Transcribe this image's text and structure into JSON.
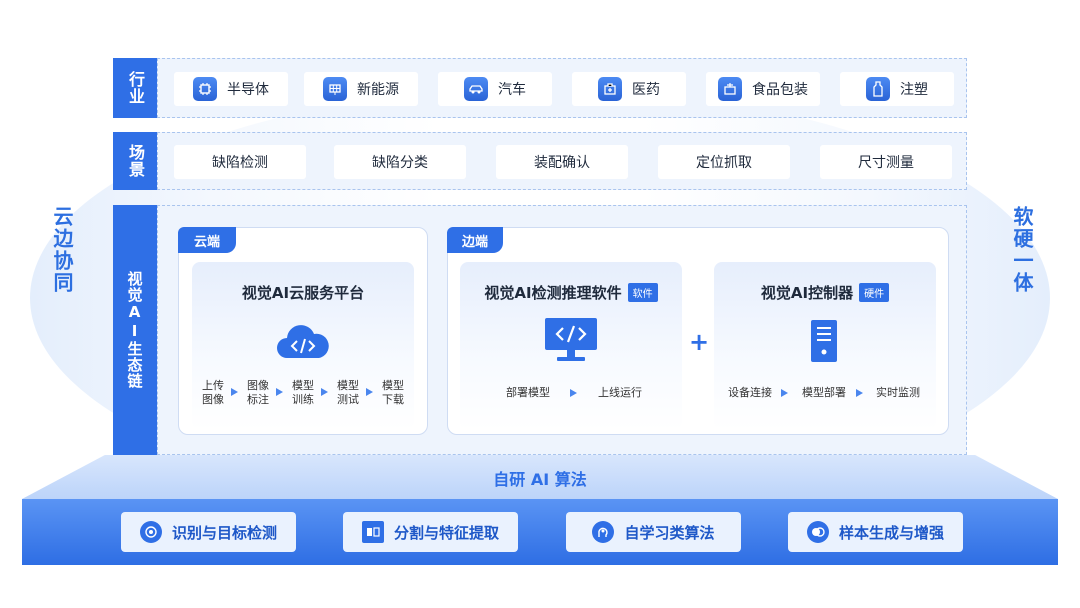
{
  "side": {
    "left": "云边协同",
    "right": "软硬一体"
  },
  "industry": {
    "tag": "行业",
    "items": [
      {
        "label": "半导体",
        "icon": "chip-icon"
      },
      {
        "label": "新能源",
        "icon": "solar-panel-icon"
      },
      {
        "label": "汽车",
        "icon": "car-icon"
      },
      {
        "label": "医药",
        "icon": "medical-kit-icon"
      },
      {
        "label": "食品包装",
        "icon": "food-package-icon"
      },
      {
        "label": "注塑",
        "icon": "bottle-icon"
      }
    ]
  },
  "scene": {
    "tag": "场景",
    "items": [
      "缺陷检测",
      "缺陷分类",
      "装配确认",
      "定位抓取",
      "尺寸测量"
    ]
  },
  "eco": {
    "tag": "视觉AI生态链",
    "cloud": {
      "tab": "云端",
      "title": "视觉AI云服务平台",
      "steps": [
        {
          "l1": "上传",
          "l2": "图像"
        },
        {
          "l1": "图像",
          "l2": "标注"
        },
        {
          "l1": "模型",
          "l2": "训练"
        },
        {
          "l1": "模型",
          "l2": "测试"
        },
        {
          "l1": "模型",
          "l2": "下载"
        }
      ]
    },
    "edge": {
      "tab": "边端",
      "software": {
        "title": "视觉AI检测推理软件",
        "badge": "软件",
        "steps": [
          "部署模型",
          "上线运行"
        ]
      },
      "plus": "+",
      "hardware": {
        "title": "视觉AI控制器",
        "badge": "硬件",
        "steps": [
          "设备连接",
          "模型部署",
          "实时监测"
        ]
      }
    }
  },
  "algo": {
    "title": "自研 AI 算法",
    "items": [
      {
        "label": "识别与目标检测",
        "icon": "target-icon"
      },
      {
        "label": "分割与特征提取",
        "icon": "segment-icon"
      },
      {
        "label": "自学习类算法",
        "icon": "brain-head-icon"
      },
      {
        "label": "样本生成与增强",
        "icon": "sample-icon"
      }
    ]
  },
  "colors": {
    "primary": "#2f6fe6",
    "light": "#eef4fd"
  }
}
